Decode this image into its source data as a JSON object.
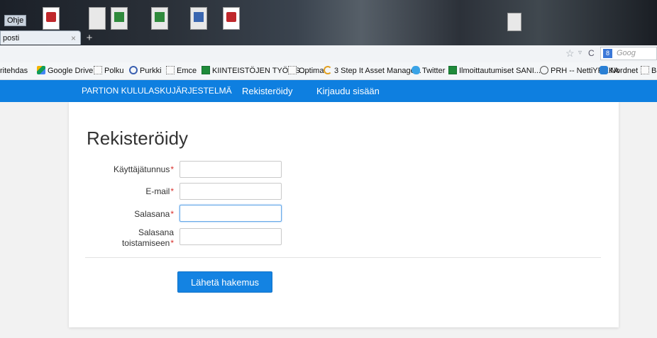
{
  "browser": {
    "menu_help": "Ohje",
    "tab_title": "posti",
    "tab_close": "×",
    "new_tab": "+",
    "star_icon": "☆",
    "dropdown_icon": "▿",
    "reload_icon": "C",
    "search_engine": "8",
    "search_placeholder": "Goog"
  },
  "bookmarks": [
    {
      "label": "ritehdas",
      "icon": "none"
    },
    {
      "label": "Google Drive",
      "icon": "drive"
    },
    {
      "label": "Polku",
      "icon": "folder"
    },
    {
      "label": "Purkki",
      "icon": "purkki"
    },
    {
      "label": "Emce",
      "icon": "folder"
    },
    {
      "label": "KIINTEISTÖJEN TYÖLIS...",
      "icon": "sheet"
    },
    {
      "label": "Optima",
      "icon": "folder"
    },
    {
      "label": "3 Step It Asset Manage...",
      "icon": "optima"
    },
    {
      "label": "Twitter",
      "icon": "twitter"
    },
    {
      "label": "Ilmoittautumiset SANI...",
      "icon": "sheet"
    },
    {
      "label": "PRH -- NettiYREKA",
      "icon": "prh"
    },
    {
      "label": "Nordnet",
      "icon": "nordnet"
    },
    {
      "label": "Ba",
      "icon": "folder"
    }
  ],
  "nav": {
    "brand": "PARTION KULULASKUJÄRJESTELMÄ",
    "register": "Rekisteröidy",
    "login": "Kirjaudu sisään"
  },
  "form": {
    "title": "Rekisteröidy",
    "required_mark": "*",
    "username_label": "Käyttäjätunnus",
    "email_label": "E-mail",
    "password_label": "Salasana",
    "password_repeat_label_1": "Salasana",
    "password_repeat_label_2": "toistamiseen",
    "username_value": "",
    "email_value": "",
    "password_value": "",
    "password_repeat_value": "",
    "submit": "Lähetä hakemus"
  },
  "colors": {
    "nav_bg": "#0e7fe0",
    "button_bg": "#1483e2",
    "required": "#d9302c"
  }
}
